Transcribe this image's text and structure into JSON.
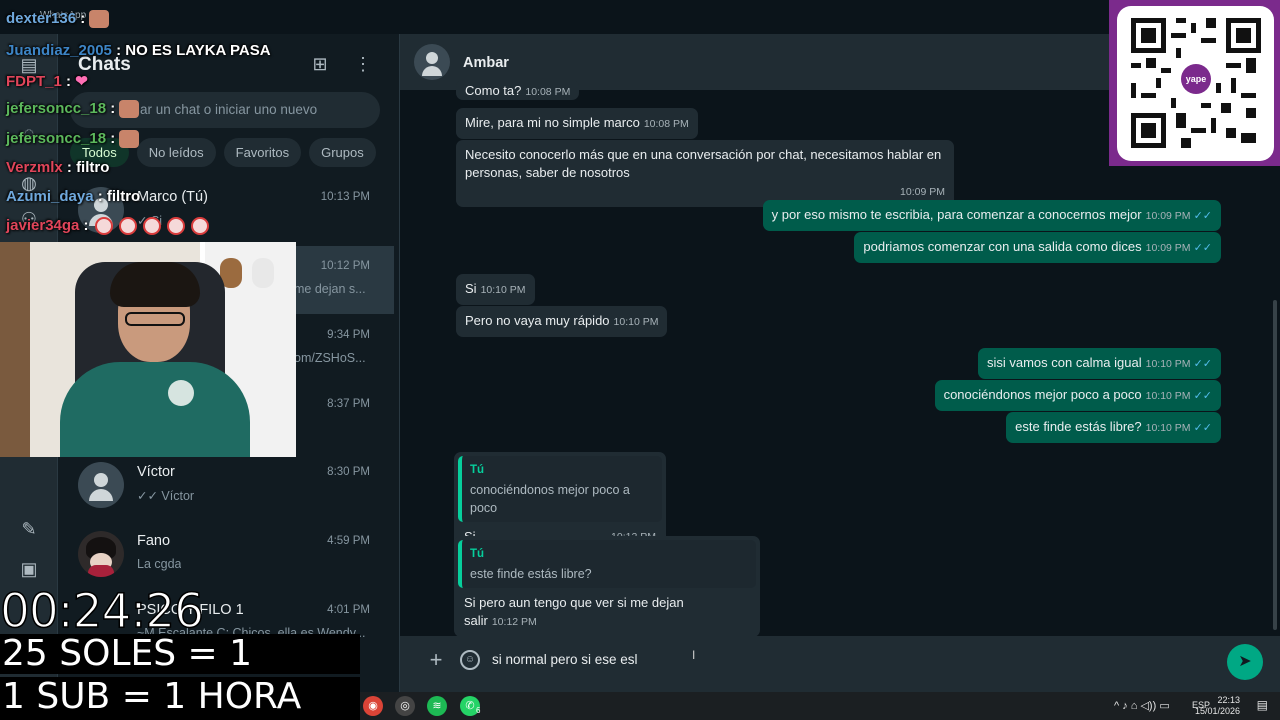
{
  "window": {
    "app_title": "WhatsApp"
  },
  "sidebar": {
    "title": "Chats",
    "search_placeholder": "ar un chat o iniciar uno nuevo",
    "filters": [
      "Todos",
      "No leídos",
      "Favoritos",
      "Grupos"
    ],
    "chats": [
      {
        "name": "Marco (Tú)",
        "time": "10:13 PM",
        "preview": "✓ Si"
      },
      {
        "name": "",
        "time": "10:12 PM",
        "preview": "me dejan s..."
      },
      {
        "name": "",
        "time": "9:34 PM",
        "preview": "om/ZSHoS..."
      },
      {
        "name": "",
        "time": "8:37 PM",
        "preview": ""
      },
      {
        "name": "Víctor",
        "time": "8:30 PM",
        "preview": "✓✓ Víctor"
      },
      {
        "name": "Fano",
        "time": "4:59 PM",
        "preview": "La cgda"
      },
      {
        "name": "PSICO Y FILO 1",
        "time": "4:01 PM",
        "preview": "~M Escalante C: Chicos, ella es Wendy..."
      }
    ]
  },
  "conversation": {
    "contact_name": "Ambar",
    "messages": [
      {
        "dir": "in",
        "text": "Como ta?",
        "time": "10:08 PM"
      },
      {
        "dir": "in",
        "text": "Mire, para mi no simple marco",
        "time": "10:08 PM"
      },
      {
        "dir": "in",
        "text": "Necesito conocerlo más que en una conversación por chat, necesitamos hablar en personas, saber de nosotros",
        "time": "10:09 PM"
      },
      {
        "dir": "out",
        "text": "y por eso mismo te escribia, para comenzar a conocernos mejor",
        "time": "10:09 PM"
      },
      {
        "dir": "out",
        "text": "podriamos comenzar con una salida como dices",
        "time": "10:09 PM"
      },
      {
        "dir": "in",
        "text": "Si",
        "time": "10:10 PM"
      },
      {
        "dir": "in",
        "text": "Pero no vaya muy rápido",
        "time": "10:10 PM"
      },
      {
        "dir": "out",
        "text": "sisi vamos con calma igual",
        "time": "10:10 PM"
      },
      {
        "dir": "out",
        "text": "conociéndonos mejor poco a poco",
        "time": "10:10 PM"
      },
      {
        "dir": "out",
        "text": "este finde estás libre?",
        "time": "10:10 PM"
      },
      {
        "dir": "in",
        "quote_author": "Tú",
        "quote_text": "conociéndonos mejor poco a poco",
        "text": "Si",
        "time": "10:12 PM"
      },
      {
        "dir": "in",
        "quote_author": "Tú",
        "quote_text": "este finde estás libre?",
        "text": "Si pero aun tengo que ver si me dejan salir",
        "time": "10:12 PM"
      }
    ],
    "composer_value": "si normal pero si ese esl"
  },
  "overlay": {
    "chat_lines": [
      {
        "user": "dexter136",
        "sep": " :",
        "msg": "",
        "color": "#6fa8dc"
      },
      {
        "user": "Juandiaz_2005",
        "sep": " : ",
        "msg": "NO ES LAYKA PASA",
        "color": "#3d85c6"
      },
      {
        "user": "FDPT_1",
        "sep": " : ",
        "msg": "",
        "color": "#e0455a"
      },
      {
        "user": "jefersoncc_18",
        "sep": " :",
        "msg": "",
        "color": "#5cb85c"
      },
      {
        "user": "jefersoncc_18",
        "sep": " :",
        "msg": "",
        "color": "#5cb85c"
      },
      {
        "user": "Verzmlx",
        "sep": " : ",
        "msg": "filtro",
        "color": "#e0455a"
      },
      {
        "user": "Azumi_daya",
        "sep": " : ",
        "msg": "filtro",
        "color": "#6fa8dc"
      },
      {
        "user": "javier34ga",
        "sep": " :",
        "msg": "",
        "color": "#e0455a"
      }
    ],
    "timer": "00:24:26",
    "promo_1": "25 SOLES = 1 HORA",
    "promo_2": "1 SUB = 1 HORA",
    "qr_brand": "yape"
  },
  "taskbar": {
    "lang": "ESP",
    "time": "22:13",
    "date": "15/01/2026",
    "whatsapp_badge": "6"
  },
  "colors": {
    "accent": "#00a884",
    "outgoing": "#005c4b",
    "incoming": "#202c33",
    "brand_purple": "#7b2a8c"
  }
}
